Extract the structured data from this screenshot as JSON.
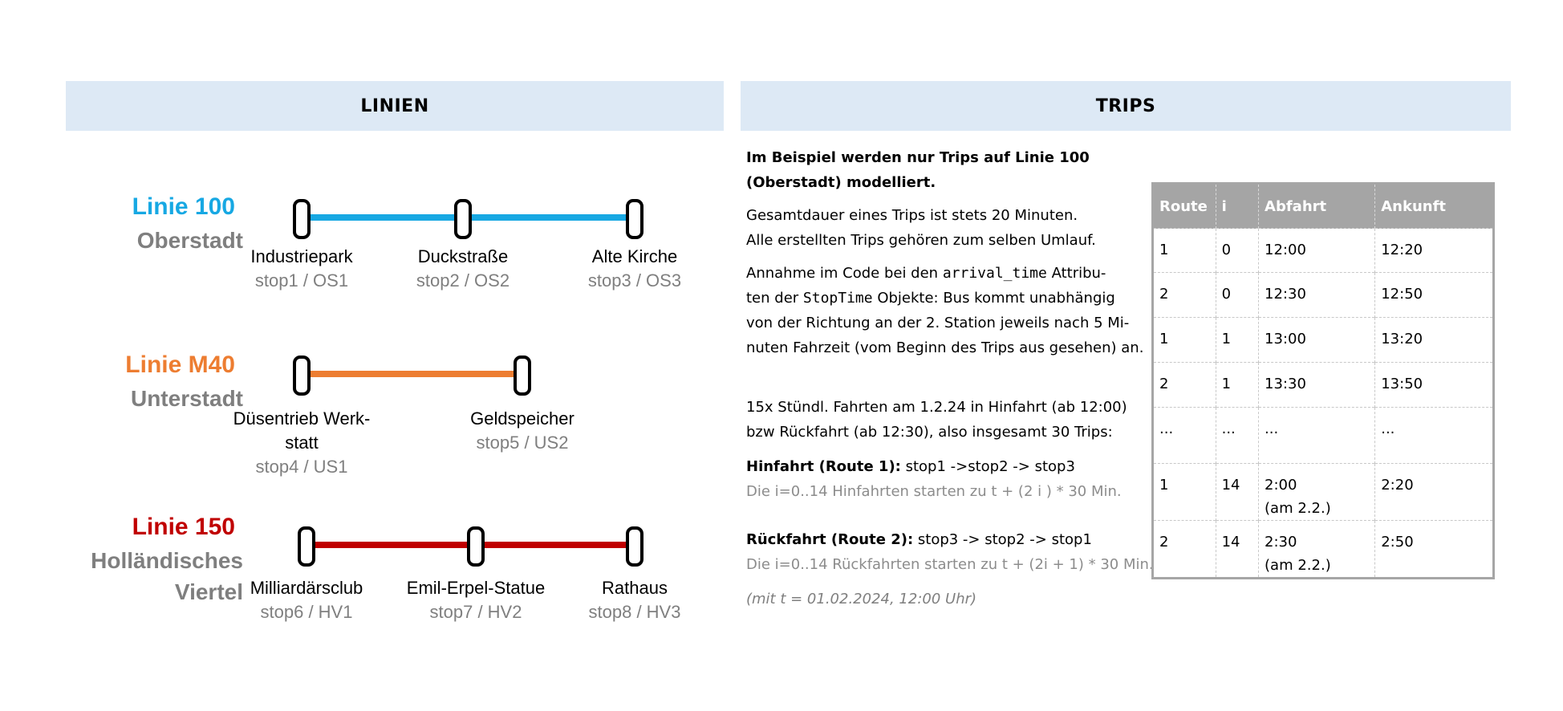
{
  "headers": {
    "linien": "LINIEN",
    "trips": "TRIPS"
  },
  "lines": [
    {
      "name": "Linie 100",
      "area": [
        "Oberstadt"
      ],
      "color": "#17a8e3",
      "stops": [
        {
          "name": [
            "Industriepark"
          ],
          "id": "stop1 / OS1"
        },
        {
          "name": [
            "Duckstraße"
          ],
          "id": "stop2 / OS2"
        },
        {
          "name": [
            "Alte Kirche"
          ],
          "id": "stop3 / OS3"
        }
      ]
    },
    {
      "name": "Linie M40",
      "area": [
        "Unterstadt"
      ],
      "color": "#ed7d31",
      "stops": [
        {
          "name": [
            "Düsentrieb Werk-",
            "statt"
          ],
          "id": "stop4 / US1"
        },
        {
          "name": [
            "Geldspeicher"
          ],
          "id": "stop5 / US2"
        }
      ]
    },
    {
      "name": "Linie 150",
      "area": [
        "Holländisches",
        "Viertel"
      ],
      "color": "#c00000",
      "stops": [
        {
          "name": [
            "Milliardärsclub"
          ],
          "id": "stop6 / HV1"
        },
        {
          "name": [
            "Emil-Erpel-Statue"
          ],
          "id": "stop7 / HV2"
        },
        {
          "name": [
            "Rathaus"
          ],
          "id": "stop8 / HV3"
        }
      ]
    }
  ],
  "trips": {
    "intro": [
      "Im Beispiel werden nur Trips auf Linie 100",
      "(Oberstadt) modelliert."
    ],
    "duration": [
      "Gesamtdauer eines Trips ist stets 20 Minuten.",
      "Alle erstellten Trips gehören zum selben Umlauf."
    ],
    "assumption": {
      "pre": "Annahme im Code bei den ",
      "code1": "arrival_time",
      "mid": " Attribu-",
      "l2pre": "ten der ",
      "code2": "StopTime",
      "l2post": " Objekte: Bus kommt unabhängig",
      "l3": "von der Richtung an der 2. Station jeweils nach 5 Mi-",
      "l4": "nuten Fahrzeit (vom Beginn des Trips aus gesehen) an."
    },
    "schedule": [
      "15x Stündl. Fahrten am 1.2.24 in Hinfahrt (ab 12:00)",
      "bzw Rückfahrt (ab 12:30), also insgesamt 30 Trips:"
    ],
    "hin": {
      "label": "Hinfahrt (Route 1):",
      "path": " stop1 ->stop2 -> stop3",
      "note": "Die i=0..14 Hinfahrten starten zu t + (2 i ) * 30 Min."
    },
    "rueck": {
      "label": "Rückfahrt (Route 2):",
      "path": " stop3 -> stop2 -> stop1",
      "note": "Die i=0..14 Rückfahrten starten zu t + (2i + 1) * 30 Min."
    },
    "tnote": "(mit t = 01.02.2024, 12:00 Uhr)"
  },
  "table": {
    "columns": [
      "Route",
      "i",
      "Abfahrt",
      "Ankunft"
    ],
    "rows": [
      [
        "1",
        "0",
        "12:00",
        "12:20"
      ],
      [
        "2",
        "0",
        "12:30",
        "12:50"
      ],
      [
        "1",
        "1",
        "13:00",
        "13:20"
      ],
      [
        "2",
        "1",
        "13:30",
        "13:50"
      ],
      [
        "...",
        "...",
        "...",
        "..."
      ],
      [
        "1",
        "14",
        "2:00\n(am 2.2.)",
        "2:20"
      ],
      [
        "2",
        "14",
        "2:30\n(am 2.2.)",
        "2:50"
      ]
    ]
  },
  "colors": {
    "header_bg": "#dde9f5",
    "table_header": "#a5a5a5",
    "muted": "#7f7f7f"
  }
}
